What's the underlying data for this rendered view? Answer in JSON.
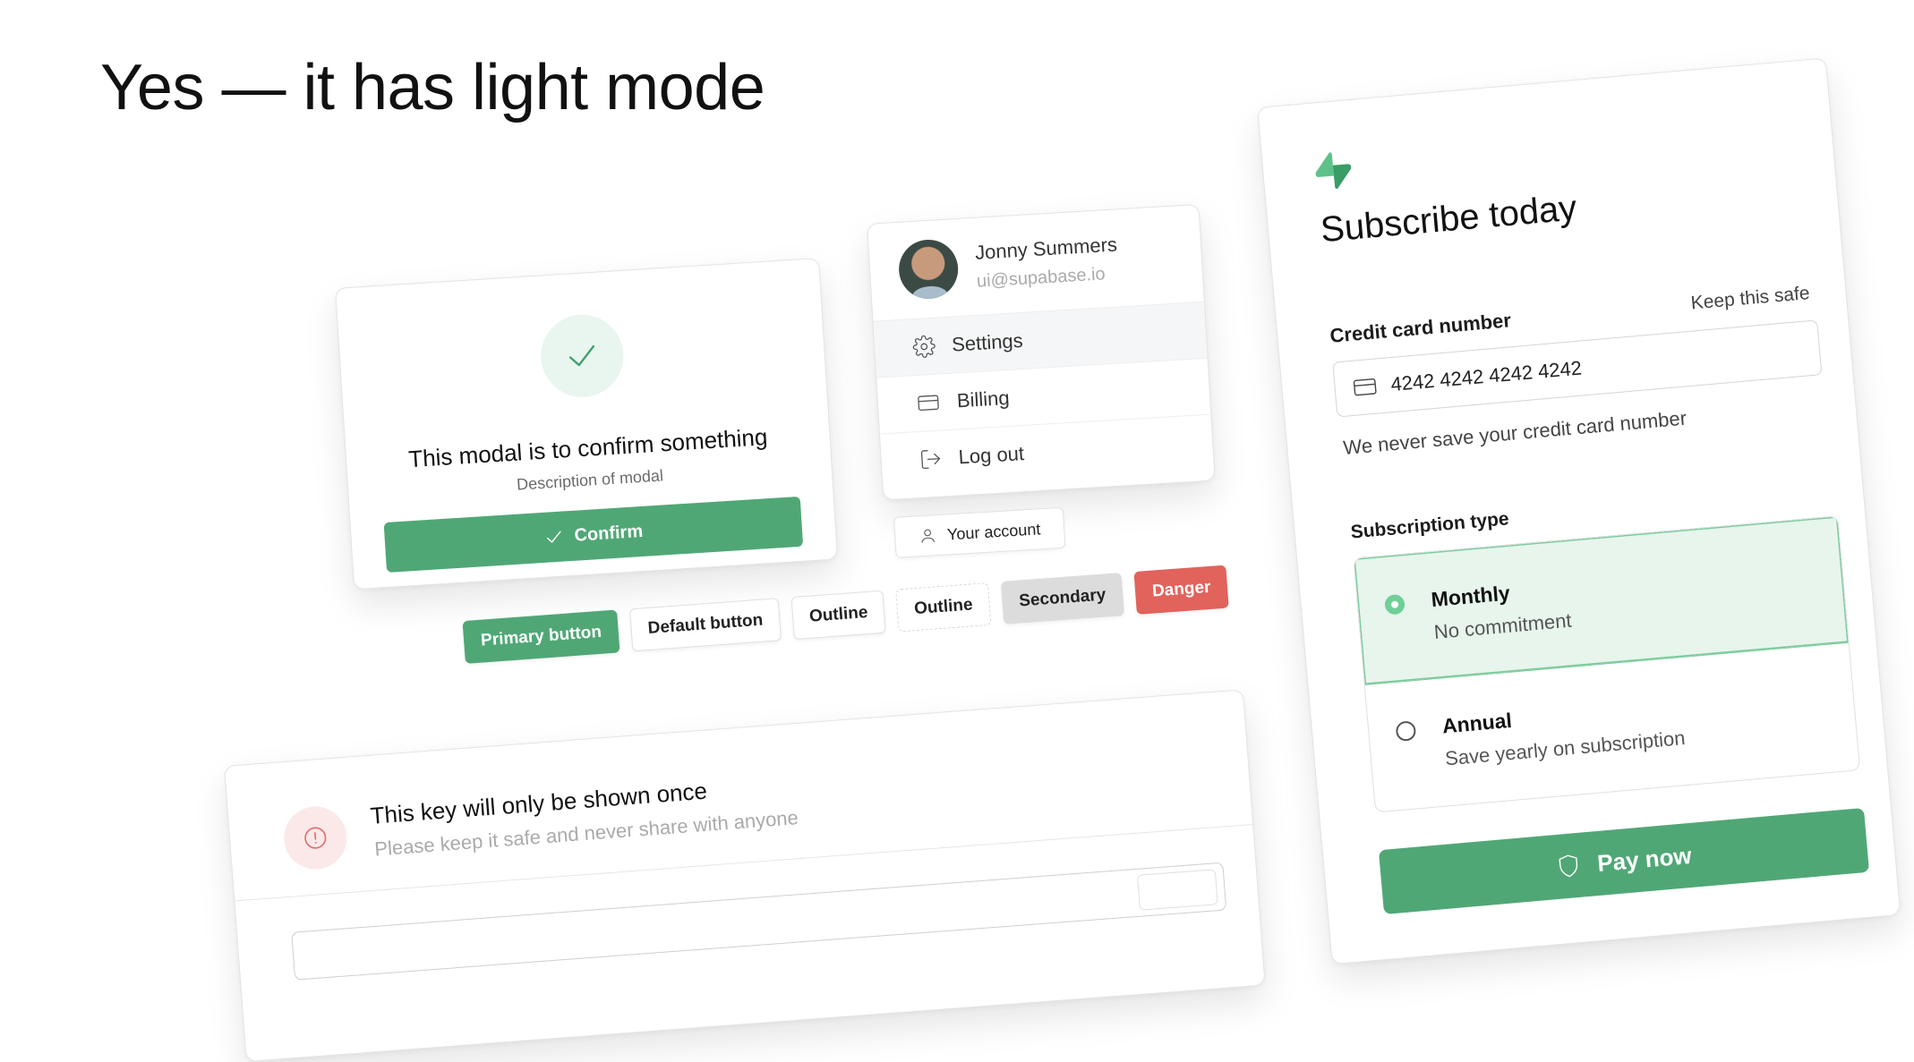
{
  "headline": "Yes — it has light mode",
  "colors": {
    "brand_green": "#50a776",
    "brand_green_light": "#e7f5ec",
    "radio_green": "#6fcf97",
    "danger_red": "#e2625c",
    "danger_light": "#fbe9e9",
    "secondary_gray": "#dcdcdc"
  },
  "confirm_modal": {
    "icon": "check-icon",
    "title": "This modal is to confirm something",
    "description": "Description of modal",
    "confirm_label": "Confirm"
  },
  "account_menu": {
    "user": {
      "name": "Jonny Summers",
      "email": "ui@supabase.io"
    },
    "items": [
      {
        "label": "Settings",
        "icon": "gear-icon",
        "active": true
      },
      {
        "label": "Billing",
        "icon": "credit-card-icon",
        "active": false
      },
      {
        "label": "Log out",
        "icon": "logout-icon",
        "active": false
      }
    ],
    "trigger_label": "Your account"
  },
  "buttons": [
    {
      "label": "Primary button",
      "variant": "primary"
    },
    {
      "label": "Default button",
      "variant": "default"
    },
    {
      "label": "Outline",
      "variant": "outline"
    },
    {
      "label": "Outline",
      "variant": "outline-dashed"
    },
    {
      "label": "Secondary",
      "variant": "secondary"
    },
    {
      "label": "Danger",
      "variant": "danger"
    }
  ],
  "key_card": {
    "icon": "alert-circle-icon",
    "title": "This key will only be shown once",
    "subtitle": "Please keep it safe and never share with anyone"
  },
  "subscribe_card": {
    "logo": "supabase-bolt-icon",
    "title": "Subscribe today",
    "card_field": {
      "label": "Credit card number",
      "hint": "Keep this safe",
      "value": "4242 4242 4242 4242",
      "help": "We never save your credit card number"
    },
    "subscription": {
      "label": "Subscription type",
      "options": [
        {
          "title": "Monthly",
          "description": "No commitment",
          "selected": true
        },
        {
          "title": "Annual",
          "description": "Save yearly on subscription",
          "selected": false
        }
      ]
    },
    "pay_label": "Pay now"
  }
}
